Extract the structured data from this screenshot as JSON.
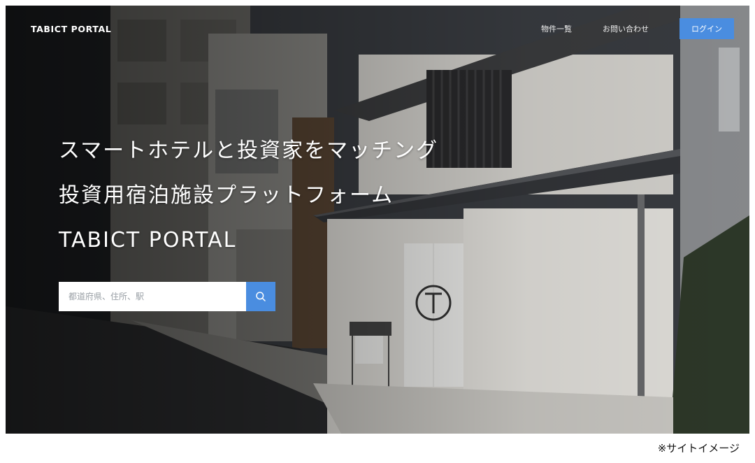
{
  "header": {
    "logo": "TABICT PORTAL",
    "nav": {
      "properties": "物件一覧",
      "contact": "お問い合わせ",
      "login": "ログイン"
    }
  },
  "hero": {
    "line1": "スマートホテルと投資家をマッチング",
    "line2": "投資用宿泊施設プラットフォーム",
    "line3": "TABICT PORTAL"
  },
  "search": {
    "placeholder": "都道府県、住所、駅",
    "button_icon": "search-icon"
  },
  "caption": "※サイトイメージ",
  "colors": {
    "accent": "#4a8de0",
    "text_on_dark": "#ffffff"
  }
}
